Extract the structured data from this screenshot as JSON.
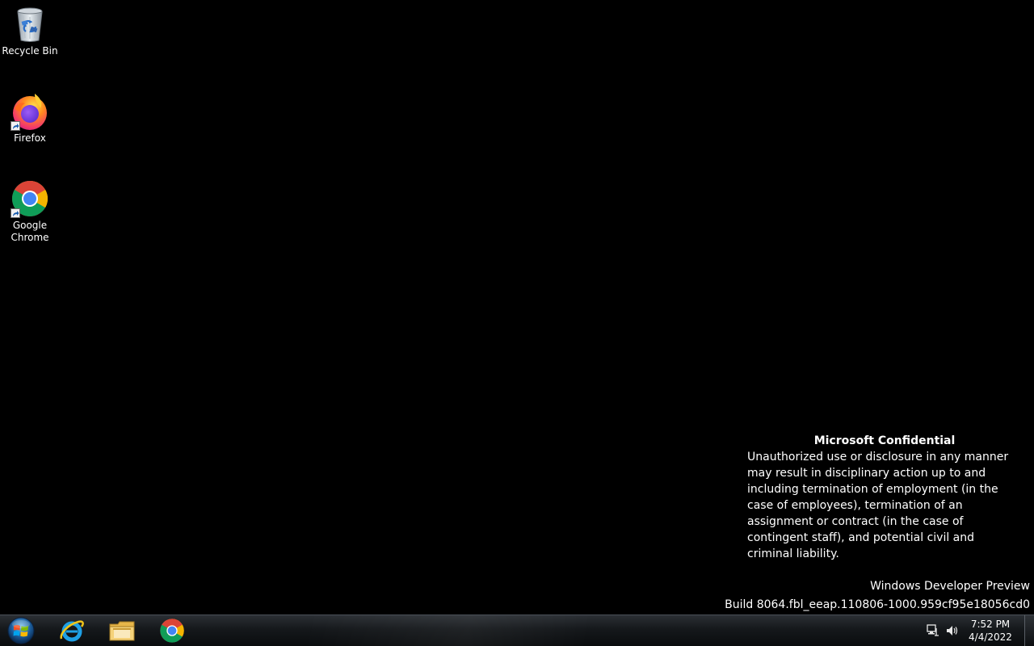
{
  "desktop": {
    "background_color": "#000000",
    "icons": [
      {
        "label": "Recycle Bin",
        "icon": "recycle-bin-icon"
      },
      {
        "label": "Firefox",
        "icon": "firefox-icon"
      },
      {
        "label": "Google\nChrome",
        "icon": "chrome-icon"
      }
    ]
  },
  "confidential": {
    "title": "Microsoft Confidential",
    "body": "Unauthorized use or disclosure in any manner may result in disciplinary action up to and including termination of employment (in the case of employees), termination of an assignment or contract (in the case of contingent staff), and potential civil and criminal liability."
  },
  "watermark": {
    "line1": "Windows Developer Preview",
    "line2": "Build 8064.fbl_eeap.110806-1000.959cf95e18056cd0"
  },
  "taskbar": {
    "pinned": [
      {
        "icon": "internet-explorer-icon"
      },
      {
        "icon": "file-explorer-icon"
      },
      {
        "icon": "chrome-icon"
      }
    ],
    "tray": {
      "icons": [
        "network-icon",
        "volume-icon"
      ]
    },
    "clock": {
      "time": "7:52 PM",
      "date": "4/4/2022"
    }
  }
}
